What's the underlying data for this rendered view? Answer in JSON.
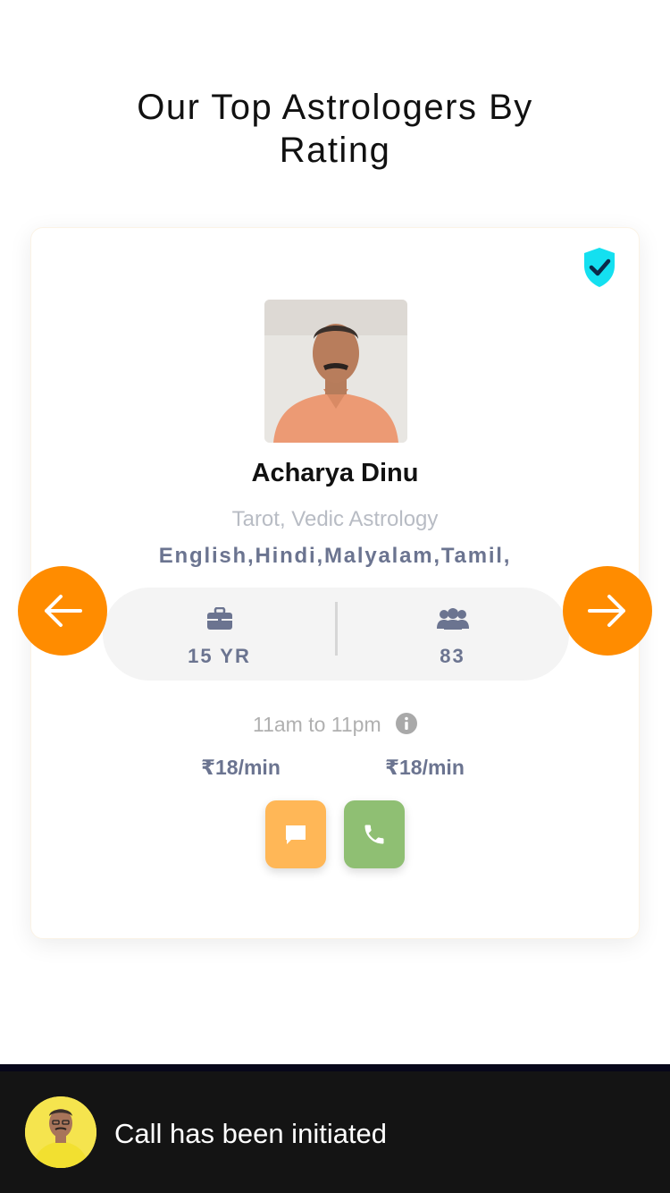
{
  "section": {
    "title": "Our Top Astrologers By Rating"
  },
  "astrologer": {
    "name": "Acharya Dinu",
    "skills": "Tarot, Vedic Astrology",
    "languages": "English,Hindi,Malyalam,Tamil,",
    "experience": "15 YR",
    "followers": "83",
    "hours": "11am to 11pm",
    "chat_price": "₹18/min",
    "call_price": "₹18/min",
    "verified": true
  },
  "toast": {
    "message": "Call has been initiated"
  },
  "icons": {
    "verified": "shield-check-icon",
    "experience": "briefcase-icon",
    "followers": "users-icon",
    "info": "info-icon",
    "chat": "chat-bubble-icon",
    "call": "phone-icon",
    "prev": "arrow-left-icon",
    "next": "arrow-right-icon"
  },
  "colors": {
    "accent": "#ff8c00",
    "verified": "#14e0f0",
    "chat_button": "#ffb757",
    "call_button": "#8fbf73",
    "toast_background": "#141414"
  }
}
